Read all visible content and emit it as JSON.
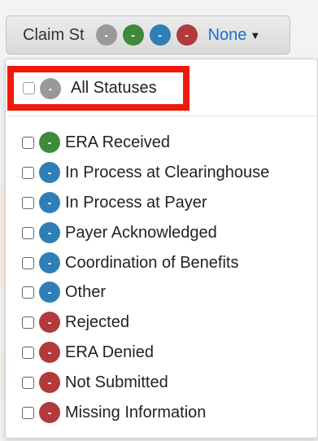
{
  "filter": {
    "label": "Claim St",
    "value": "None",
    "caret_icon": "caret-down-icon",
    "dots": [
      {
        "color": "gray",
        "symbol": "-"
      },
      {
        "color": "green",
        "symbol": "-"
      },
      {
        "color": "blue",
        "symbol": "-"
      },
      {
        "color": "red",
        "symbol": "-"
      }
    ]
  },
  "menu": {
    "all": {
      "label": "All Statuses",
      "symbol": "-",
      "color": "gray"
    },
    "options": [
      {
        "label": "ERA Received",
        "symbol": "-",
        "color": "green"
      },
      {
        "label": "In Process at Clearinghouse",
        "symbol": "-",
        "color": "blue"
      },
      {
        "label": "In Process at Payer",
        "symbol": "-",
        "color": "blue"
      },
      {
        "label": "Payer Acknowledged",
        "symbol": "-",
        "color": "blue"
      },
      {
        "label": "Coordination of Benefits",
        "symbol": "-",
        "color": "blue"
      },
      {
        "label": "Other",
        "symbol": "-",
        "color": "blue"
      },
      {
        "label": "Rejected",
        "symbol": "-",
        "color": "red"
      },
      {
        "label": "ERA Denied",
        "symbol": "-",
        "color": "red"
      },
      {
        "label": "Not Submitted",
        "symbol": "-",
        "color": "red"
      },
      {
        "label": "Missing Information",
        "symbol": "-",
        "color": "red"
      }
    ]
  },
  "colors": {
    "gray": "#999999",
    "green": "#3e8a3c",
    "blue": "#2f7fb6",
    "red": "#b33a3a",
    "highlight": "#f0190a",
    "link": "#1a6fd1"
  }
}
